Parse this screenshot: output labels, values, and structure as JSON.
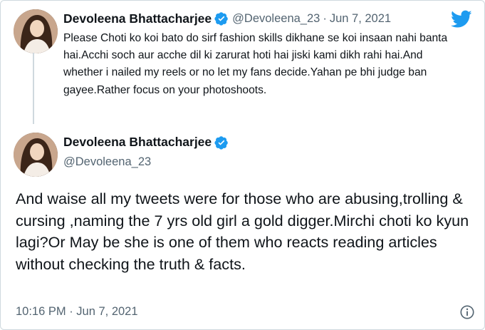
{
  "reply_tweet": {
    "author_name": "Devoleena Bhattacharjee",
    "handle": "@Devoleena_23",
    "separator": "·",
    "date": "Jun 7, 2021",
    "text": "Please Choti ko koi bato do sirf fashion skills dikhane se koi insaan nahi banta hai.Acchi soch aur acche dil ki zarurat hoti hai jiski kami dikh rahi hai.And whether i nailed my reels or no let my fans decide.Yahan pe bhi judge ban gayee.Rather focus on your photoshoots."
  },
  "main_tweet": {
    "author_name": "Devoleena Bhattacharjee",
    "handle": "@Devoleena_23",
    "text": "And waise all my tweets were for those who are abusing,trolling & cursing ,naming the 7 yrs old girl a gold digger.Mirchi choti ko kyun lagi?Or May be she is one of them who reacts reading articles without checking the truth & facts.",
    "timestamp": "10:16 PM · Jun 7, 2021"
  },
  "icons": {
    "brand": "twitter-bird-icon",
    "verified": "verified-badge-icon",
    "info": "info-icon"
  },
  "colors": {
    "twitter_blue": "#1d9bf0",
    "secondary_text": "#536471",
    "primary_text": "#0f1419"
  }
}
